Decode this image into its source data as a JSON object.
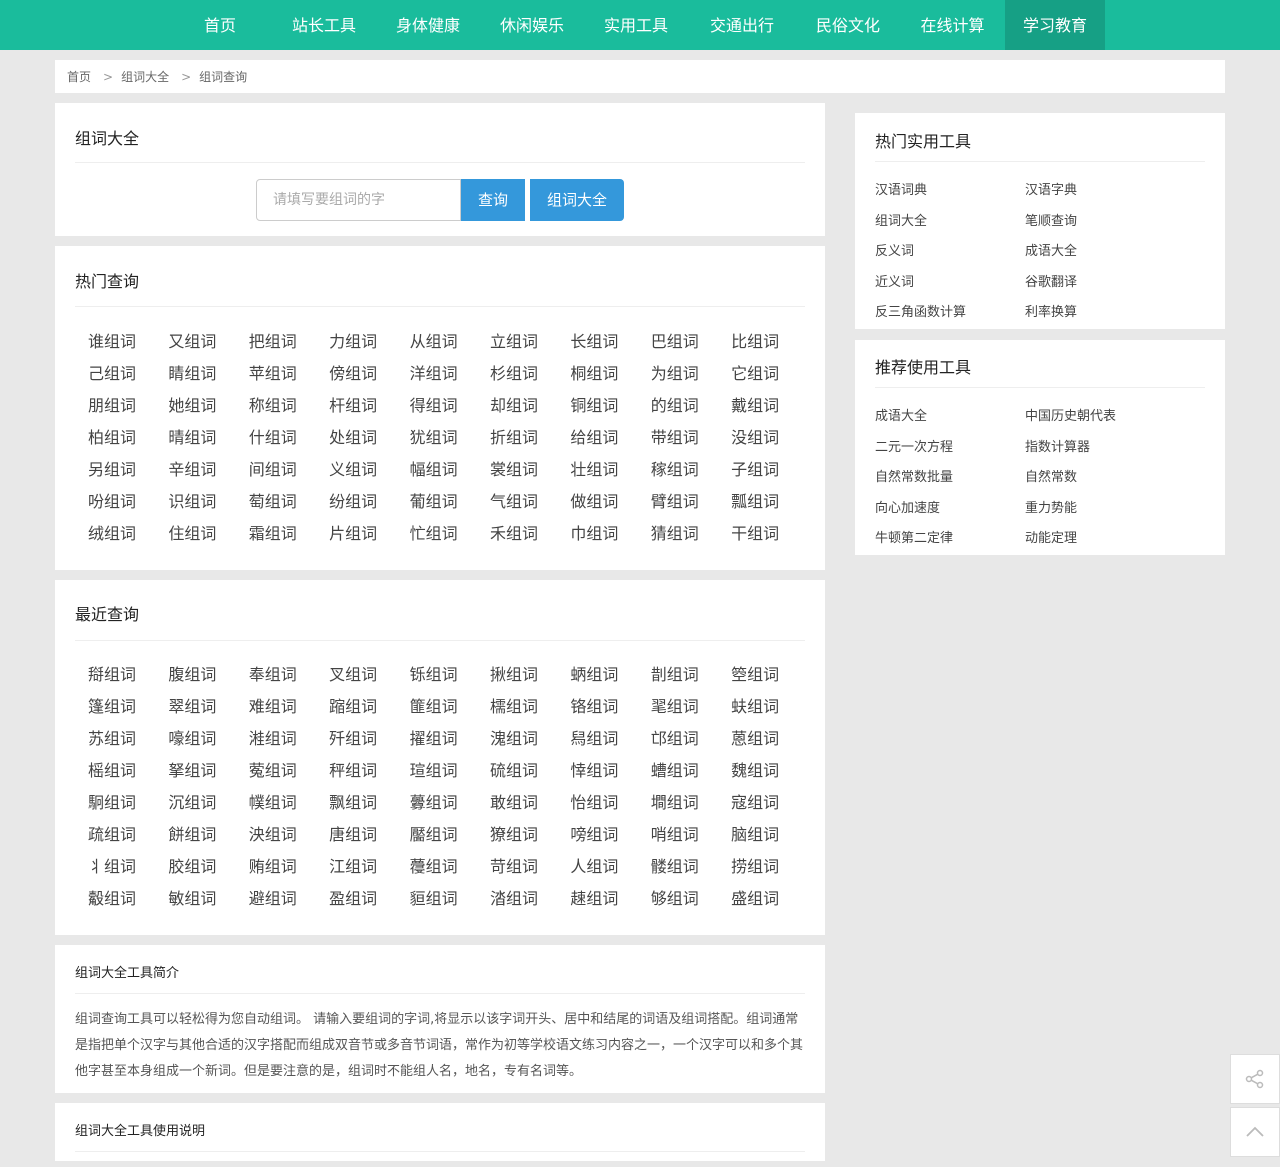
{
  "nav": {
    "items": [
      "首页",
      "站长工具",
      "身体健康",
      "休闲娱乐",
      "实用工具",
      "交通出行",
      "民俗文化",
      "在线计算",
      "学习教育"
    ],
    "active_index": 8
  },
  "breadcrumb": [
    "首页",
    "组词大全",
    "组词查询"
  ],
  "breadcrumb_sep": ">",
  "search": {
    "title": "组词大全",
    "placeholder": "请填写要组词的字",
    "query_label": "查询",
    "all_label": "组词大全"
  },
  "hot": {
    "title": "热门查询",
    "items": [
      "谁组词",
      "又组词",
      "把组词",
      "力组词",
      "从组词",
      "立组词",
      "长组词",
      "巴组词",
      "比组词",
      "己组词",
      "睛组词",
      "苹组词",
      "傍组词",
      "洋组词",
      "杉组词",
      "桐组词",
      "为组词",
      "它组词",
      "朋组词",
      "她组词",
      "称组词",
      "杆组词",
      "得组词",
      "却组词",
      "铜组词",
      "的组词",
      "戴组词",
      "柏组词",
      "晴组词",
      "什组词",
      "处组词",
      "犹组词",
      "折组词",
      "给组词",
      "带组词",
      "没组词",
      "另组词",
      "辛组词",
      "间组词",
      "义组词",
      "幅组词",
      "裳组词",
      "壮组词",
      "稼组词",
      "子组词",
      "吩组词",
      "识组词",
      "萄组词",
      "纷组词",
      "葡组词",
      "气组词",
      "做组词",
      "臂组词",
      "瓢组词",
      "绒组词",
      "住组词",
      "霜组词",
      "片组词",
      "忙组词",
      "禾组词",
      "巾组词",
      "猜组词",
      "干组词"
    ]
  },
  "recent": {
    "title": "最近查询",
    "items": [
      "搿组词",
      "腹组词",
      "奉组词",
      "叉组词",
      "铄组词",
      "揪组词",
      "蛃组词",
      "剒组词",
      "箜组词",
      "篷组词",
      "翠组词",
      "难组词",
      "蹜组词",
      "篚组词",
      "檽组词",
      "铬组词",
      "毣组词",
      "蚨组词",
      "苏组词",
      "嚎组词",
      "溎组词",
      "歼组词",
      "擢组词",
      "溾组词",
      "舄组词",
      "邙组词",
      "蒽组词",
      "榣组词",
      "拏组词",
      "蒬组词",
      "秤组词",
      "瑄组词",
      "硫组词",
      "悻组词",
      "螬组词",
      "魏组词",
      "駉组词",
      "沉组词",
      "幞组词",
      "飘组词",
      "虋组词",
      "敢组词",
      "怡组词",
      "墹组词",
      "寇组词",
      "疏组词",
      "餅组词",
      "泱组词",
      "唐组词",
      "靨组词",
      "獠组词",
      "嗙组词",
      "哨组词",
      "脑组词",
      "丬组词",
      "胶组词",
      "贿组词",
      "江组词",
      "蘉组词",
      "苛组词",
      "人组词",
      "髅组词",
      "捞组词",
      "觳组词",
      "敏组词",
      "避组词",
      "盈组词",
      "貆组词",
      "涾组词",
      "趚组词",
      "够组词",
      "盛组词"
    ]
  },
  "intro": {
    "title": "组词大全工具简介",
    "text": "组词查询工具可以轻松得为您自动组词。 请输入要组词的字词,将显示以该字词开头、居中和结尾的词语及组词搭配。组词通常是指把单个汉字与其他合适的汉字搭配而组成双音节或多音节词语，常作为初等学校语文练习内容之一，一个汉字可以和多个其他字甚至本身组成一个新词。但是要注意的是，组词时不能组人名，地名，专有名词等。"
  },
  "usage": {
    "title": "组词大全工具使用说明"
  },
  "sidebar": {
    "hot_tools": {
      "title": "热门实用工具",
      "links": [
        "汉语词典",
        "汉语字典",
        "组词大全",
        "笔顺查询",
        "反义词",
        "成语大全",
        "近义词",
        "谷歌翻译",
        "反三角函数计算",
        "利率换算"
      ]
    },
    "recommend_tools": {
      "title": "推荐使用工具",
      "links": [
        "成语大全",
        "中国历史朝代表",
        "二元一次方程",
        "指数计算器",
        "自然常数批量",
        "自然常数",
        "向心加速度",
        "重力势能",
        "牛顿第二定律",
        "动能定理"
      ]
    }
  },
  "floating": [
    "share-icon",
    "back-to-top-icon"
  ],
  "colors": {
    "nav": "#1abc9c",
    "nav_active": "#16a085",
    "button": "#3498db"
  }
}
